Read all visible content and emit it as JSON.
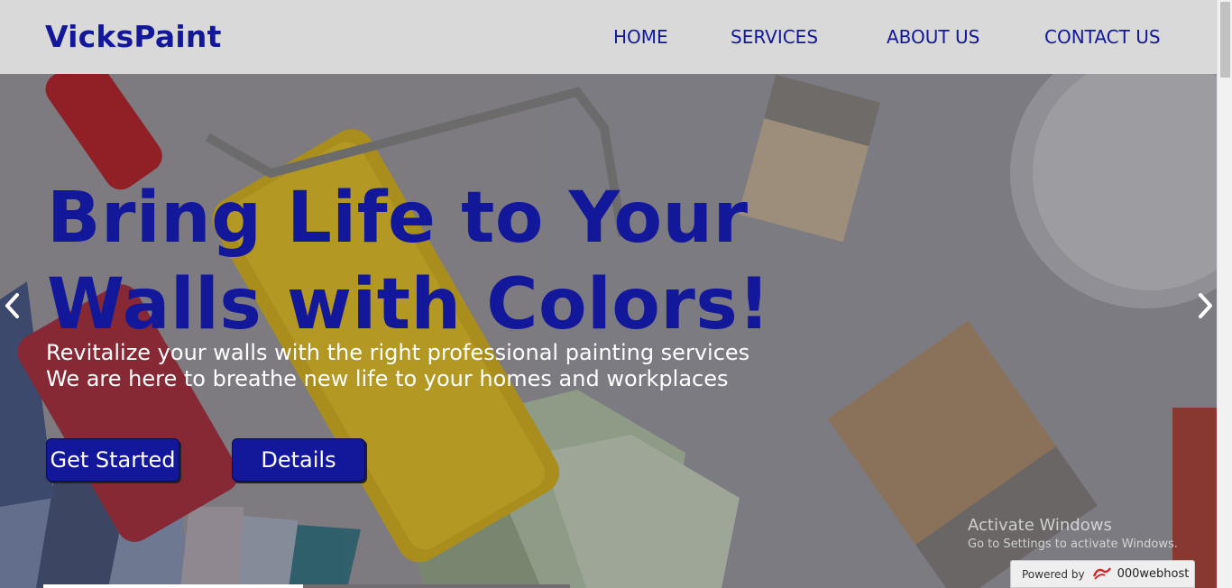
{
  "brand": "VicksPaint",
  "nav": {
    "home": "HOME",
    "services": "SERVICES",
    "about": "ABOUT US",
    "contact": "CONTACT US"
  },
  "hero": {
    "title_line1": "Bring Life to Your",
    "title_line2": "Walls with Colors!",
    "subtitle_line1": "Revitalize your walls with the right professional painting services",
    "subtitle_line2": "We are here to breathe new life to your homes and workplaces",
    "primary_button": "Get Started",
    "secondary_button": "Details",
    "prev_icon": "chevron-left-icon",
    "next_icon": "chevron-right-icon"
  },
  "watermark": {
    "title": "Activate Windows",
    "subtitle": "Go to Settings to activate Windows."
  },
  "badge": {
    "prefix": "Powered by",
    "name": "000webhost"
  },
  "colors": {
    "brand": "#13179a",
    "header_bg": "#d9d9d9",
    "button_bg": "#13179a",
    "hero_text": "#ffffff"
  }
}
